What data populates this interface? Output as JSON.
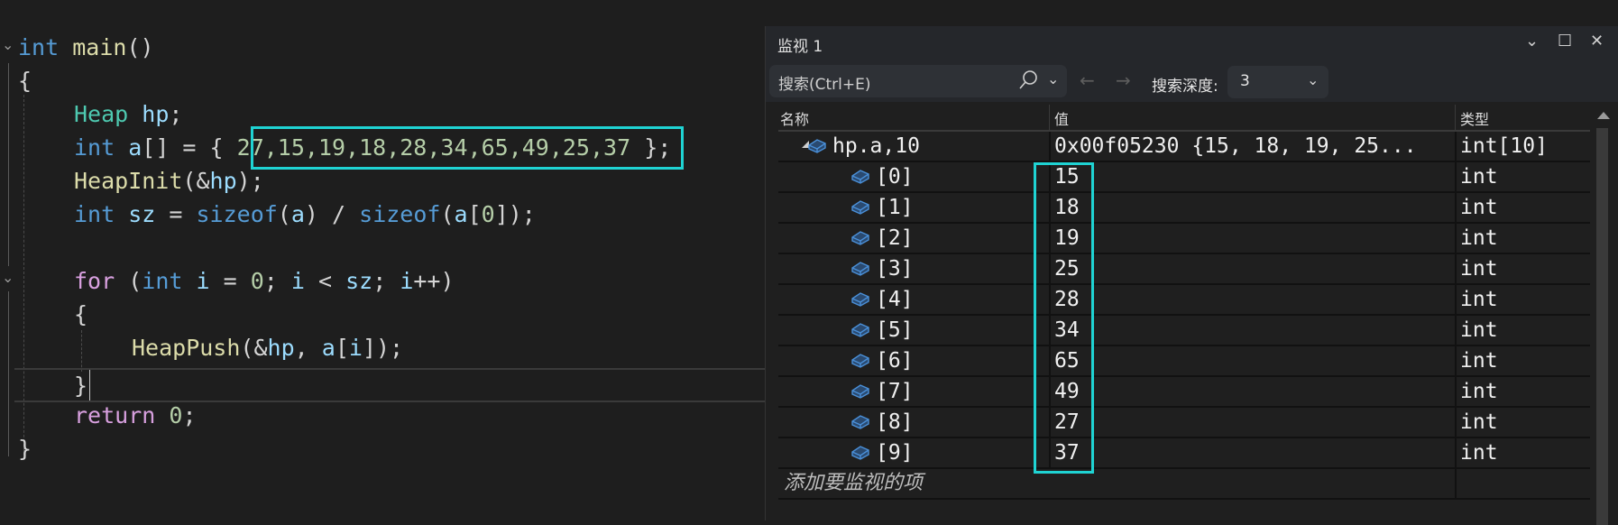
{
  "editor": {
    "lines": {
      "l1": {
        "kw": "int",
        "fn": "main",
        "rest": "()"
      },
      "l2": {
        "text": "{"
      },
      "l3": {
        "ty": "Heap",
        "var": "hp",
        "rest": ";"
      },
      "l4": {
        "kw": "int",
        "var": "a",
        "mid": "[] = { ",
        "nums": "27,15,19,18,28,34,65,49,25,37",
        "end": " };"
      },
      "l5": {
        "fn": "HeapInit",
        "p1": "(&",
        "var": "hp",
        "p2": ");"
      },
      "l6": {
        "kw": "int",
        "var": "sz",
        "eq": " = ",
        "fn1": "sizeof",
        "a1": "a",
        "div": ") / ",
        "fn2": "sizeof",
        "a2": "a",
        "zero": "0",
        "end": "]);"
      },
      "l8": {
        "ctl": "for",
        "p1": " (",
        "kw": "int",
        "i1": "i",
        "eq": " = ",
        "zero": "0",
        "semi1": "; ",
        "i2": "i",
        "lt": " < ",
        "sz": "sz",
        "semi2": "; ",
        "i3": "i",
        "inc": "++)"
      },
      "l9": {
        "text": "{"
      },
      "l10": {
        "fn": "HeapPush",
        "p1": "(&",
        "hp": "hp",
        "comma": ", ",
        "a": "a",
        "br": "[",
        "i": "i",
        "end": "]);"
      },
      "l11": {
        "text": "}"
      },
      "l12": {
        "ctl": "return",
        "zero": "0",
        "end": ";"
      },
      "l13": {
        "text": "}"
      }
    },
    "highlight_color": "#1fd3d3"
  },
  "watch": {
    "title": "监视 1",
    "window_buttons": {
      "dropdown": "⌄",
      "maximize": "☐",
      "close": "✕"
    },
    "search": {
      "placeholder": "搜索(Ctrl+E)",
      "icon": "search-icon",
      "dropdown": "⌄"
    },
    "nav": {
      "back": "←",
      "forward": "→"
    },
    "depth": {
      "label": "搜索深度:",
      "value": "3",
      "dropdown": "⌄"
    },
    "columns": {
      "name": "名称",
      "value": "值",
      "type": "类型"
    },
    "root": {
      "name": "hp.a,10",
      "value": "0x00f05230 {15, 18, 19, 25...",
      "type": "int[10]"
    },
    "items": [
      {
        "name": "[0]",
        "value": "15",
        "type": "int"
      },
      {
        "name": "[1]",
        "value": "18",
        "type": "int"
      },
      {
        "name": "[2]",
        "value": "19",
        "type": "int"
      },
      {
        "name": "[3]",
        "value": "25",
        "type": "int"
      },
      {
        "name": "[4]",
        "value": "28",
        "type": "int"
      },
      {
        "name": "[5]",
        "value": "34",
        "type": "int"
      },
      {
        "name": "[6]",
        "value": "65",
        "type": "int"
      },
      {
        "name": "[7]",
        "value": "49",
        "type": "int"
      },
      {
        "name": "[8]",
        "value": "27",
        "type": "int"
      },
      {
        "name": "[9]",
        "value": "37",
        "type": "int"
      }
    ],
    "add_item_placeholder": "添加要监视的项"
  }
}
